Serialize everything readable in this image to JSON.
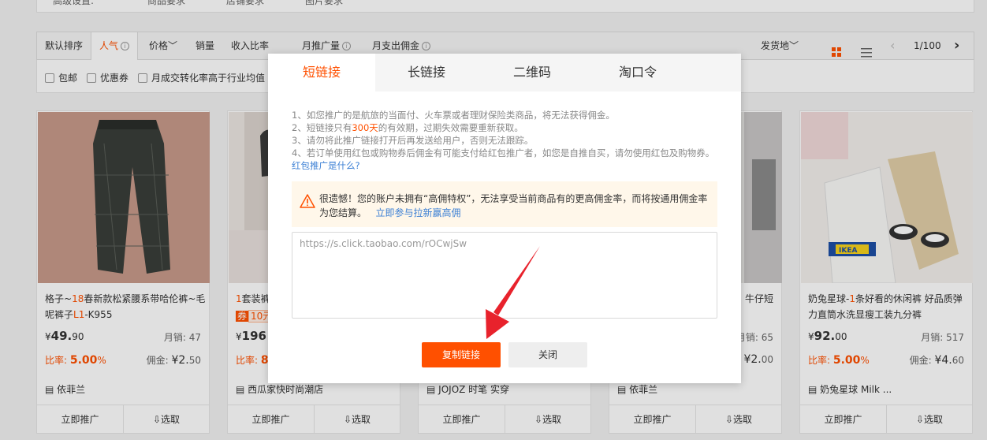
{
  "advanced": {
    "label": "高级设置:",
    "items": [
      "商品要求﹀",
      "店铺要求﹀",
      "图片要求﹀"
    ]
  },
  "sortbar": {
    "default": "默认排序",
    "popular": "人气",
    "price": "价格﹀",
    "sales": "销量",
    "ratio": "收入比率",
    "monthly_promo": "月推广量",
    "monthly_pay": "月支出佣金",
    "ship_from": "发货地﹀",
    "page": "1/100"
  },
  "filters": [
    "包邮",
    "优惠券",
    "月成交转化率高于行业均值"
  ],
  "products": [
    {
      "title_a": "格子~",
      "title_hl": "18",
      "title_b": "春新款松紧腰系带哈伦裤~毛呢裤子",
      "title_hl2": "L1",
      "title_c": "-K955",
      "price": "49.",
      "price_dec": "90",
      "sales": "月销: 47",
      "rate_label": "比率: ",
      "rate": "5.00",
      "rate_unit": "%",
      "comm_label": "佣金: ",
      "comm": "¥2.",
      "comm_dec": "50",
      "shop": "依菲兰"
    },
    {
      "title_a": "1",
      "title_hl": "套装裤",
      "price": "196",
      "coupon": "券",
      "coupon_val": "10元",
      "rate_label": "比率: ",
      "rate": "8",
      "shop": "西瓜家快时尚潮店"
    },
    {
      "shop": "JOJOZ 时笔 实穿"
    },
    {
      "title_tail": "牛仔短",
      "sales": "月销: 65",
      "comm": "¥2.",
      "comm_dec": "00",
      "shop": "依菲兰"
    },
    {
      "title_a": "奶兔星球-",
      "title_hl": "1",
      "title_b": "条好看的休闲裤 好品质弹力直筒水洗显瘦工装九分裤",
      "price": "92.",
      "price_dec": "00",
      "sales": "月销: 517",
      "rate_label": "比率: ",
      "rate": "5.00",
      "rate_unit": "%",
      "comm_label": "佣金: ",
      "comm": "¥4.",
      "comm_dec": "60",
      "shop": "奶兔星球 Milk ..."
    }
  ],
  "card_actions": {
    "promote": "立即推广",
    "select": "⇩选取"
  },
  "modal": {
    "tabs": [
      "短链接",
      "长链接",
      "二维码",
      "淘口令"
    ],
    "note1": "1、如您推广的是航旅的当面付、火车票或者理财保险类商品，将无法获得佣金。",
    "note2_a": "2、短链接只有",
    "note2_hl": "300天",
    "note2_b": "的有效期，过期失效需要重新获取。",
    "note3": "3、请勿将此推广链接打开后再发送给用户，否则无法跟踪。",
    "note4": "4、若订单使用红包或购物券后佣金有可能支付给红包推广者，如您是自推自买，请勿使用红包及购物券。",
    "note4_link": "红包推广是什么?",
    "warn_text": "很遗憾！您的账户未拥有“高佣特权”，无法享受当前商品有的更高佣金率，而将按通用佣金率为您结算。",
    "warn_link": "立即参与拉新赢高佣",
    "url": "https://s.click.taobao.com/rOCwjSw",
    "copy": "复制链接",
    "close": "关闭"
  },
  "colors": {
    "accent": "#ff5000",
    "link": "#3b7fd4"
  }
}
